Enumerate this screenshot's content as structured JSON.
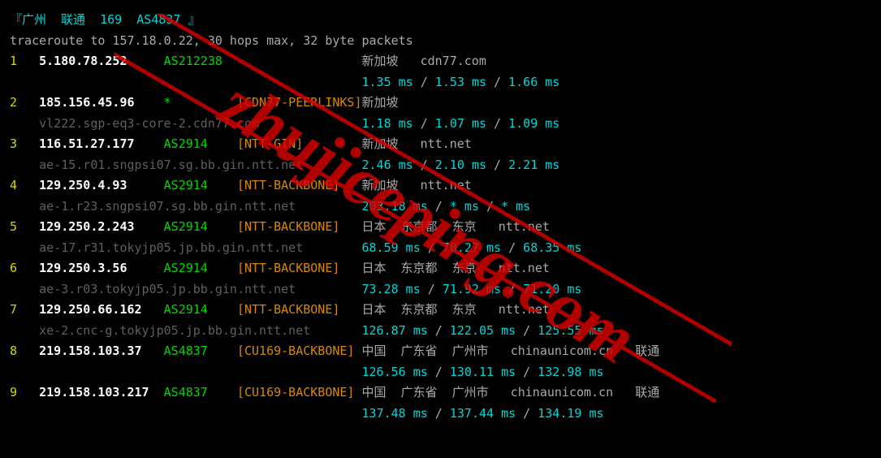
{
  "header": {
    "title": "『广州  联通  169  AS4837 』",
    "cmd": "traceroute to 157.18.0.22, 30 hops max, 32 byte packets"
  },
  "hops": [
    {
      "n": "1",
      "ip": "5.180.78.252",
      "asn": "AS212238",
      "tag": "",
      "loc": "新加坡",
      "net": "cdn77.com",
      "t1": "1.35 ms",
      "t2": "1.53 ms",
      "t3": "1.66 ms",
      "rdns": ""
    },
    {
      "n": "2",
      "ip": "185.156.45.96",
      "asn": "*",
      "tag": "[CDN77-PEERLINKS]",
      "loc": "新加坡",
      "net": "",
      "t1": "1.18 ms",
      "t2": "1.07 ms",
      "t3": "1.09 ms",
      "rdns": "vl222.sgp-eq3-core-2.cdn77.com"
    },
    {
      "n": "3",
      "ip": "116.51.27.177",
      "asn": "AS2914",
      "tag": "[NTT-GIN]",
      "loc": "新加坡",
      "net": "ntt.net",
      "t1": "2.46 ms",
      "t2": "2.10 ms",
      "t3": "2.21 ms",
      "rdns": "ae-15.r01.sngpsi07.sg.bb.gin.ntt.net"
    },
    {
      "n": "4",
      "ip": "129.250.4.93",
      "asn": "AS2914",
      "tag": "[NTT-BACKBONE]",
      "loc": "新加坡",
      "net": "ntt.net",
      "t1": "203.18 ms",
      "t2": "* ms",
      "t3": "* ms",
      "rdns": "ae-1.r23.sngpsi07.sg.bb.gin.ntt.net"
    },
    {
      "n": "5",
      "ip": "129.250.2.243",
      "asn": "AS2914",
      "tag": "[NTT-BACKBONE]",
      "loc": "日本  东京都  东京",
      "net": "ntt.net",
      "t1": "68.59 ms",
      "t2": "70.27 ms",
      "t3": "68.35 ms",
      "rdns": "ae-17.r31.tokyjp05.jp.bb.gin.ntt.net"
    },
    {
      "n": "6",
      "ip": "129.250.3.56",
      "asn": "AS2914",
      "tag": "[NTT-BACKBONE]",
      "loc": "日本  东京都  东京",
      "net": "ntt.net",
      "t1": "73.28 ms",
      "t2": "71.92 ms",
      "t3": "71.20 ms",
      "rdns": "ae-3.r03.tokyjp05.jp.bb.gin.ntt.net"
    },
    {
      "n": "7",
      "ip": "129.250.66.162",
      "asn": "AS2914",
      "tag": "[NTT-BACKBONE]",
      "loc": "日本  东京都  东京",
      "net": "ntt.net",
      "t1": "126.87 ms",
      "t2": "122.05 ms",
      "t3": "125.55 ms",
      "rdns": "xe-2.cnc-g.tokyjp05.jp.bb.gin.ntt.net"
    },
    {
      "n": "8",
      "ip": "219.158.103.37",
      "asn": "AS4837",
      "tag": "[CU169-BACKBONE]",
      "loc": "中国  广东省  广州市",
      "net": "chinaunicom.cn   联通",
      "t1": "126.56 ms",
      "t2": "130.11 ms",
      "t3": "132.98 ms",
      "rdns": ""
    },
    {
      "n": "9",
      "ip": "219.158.103.217",
      "asn": "AS4837",
      "tag": "[CU169-BACKBONE]",
      "loc": "中国  广东省  广州市",
      "net": "chinaunicom.cn   联通",
      "t1": "137.48 ms",
      "t2": "137.44 ms",
      "t3": "134.19 ms",
      "rdns": ""
    }
  ],
  "watermark": {
    "text": "zhujiceping.com"
  }
}
